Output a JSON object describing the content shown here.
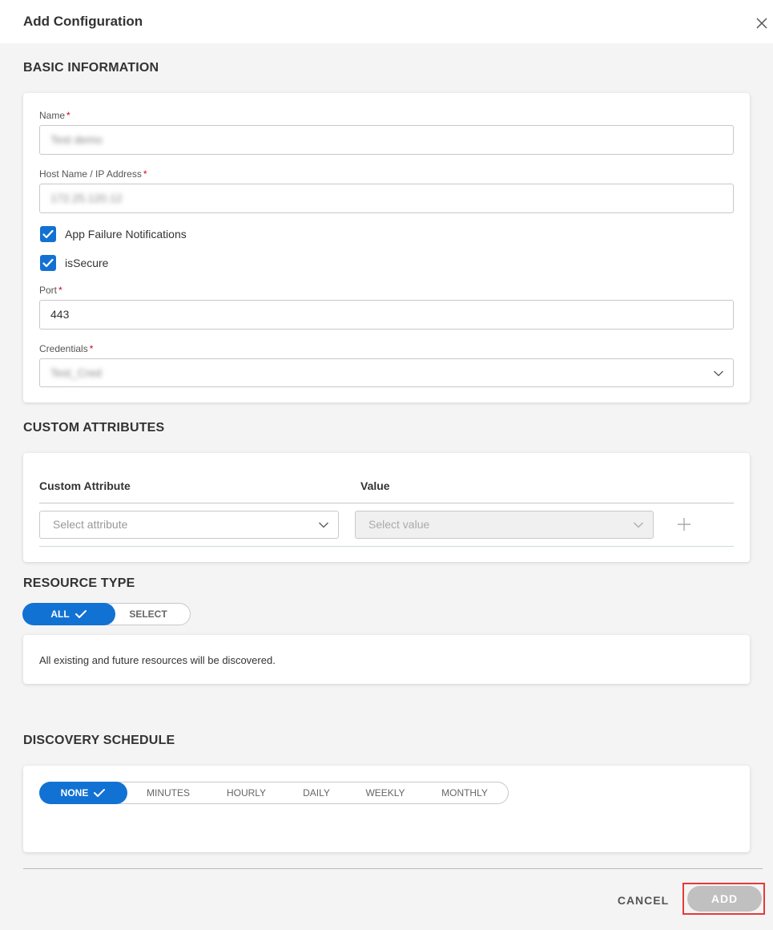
{
  "header": {
    "title": "Add Configuration",
    "close_icon": "close-icon"
  },
  "basic_info": {
    "section_title": "BASIC INFORMATION",
    "name": {
      "label": "Name",
      "required_mark": "*",
      "value": "Test demo"
    },
    "host": {
      "label": "Host Name / IP Address",
      "required_mark": "*",
      "value": "172.25.120.12"
    },
    "app_failure": {
      "label": "App Failure Notifications",
      "checked": true
    },
    "is_secure": {
      "label": "isSecure",
      "checked": true
    },
    "port": {
      "label": "Port",
      "required_mark": "*",
      "value": "443"
    },
    "credentials": {
      "label": "Credentials",
      "required_mark": "*",
      "value": "Test_Cred"
    }
  },
  "custom_attributes": {
    "section_title": "CUSTOM ATTRIBUTES",
    "col_attribute": "Custom Attribute",
    "col_value": "Value",
    "attribute_placeholder": "Select attribute",
    "value_placeholder": "Select value"
  },
  "resource_type": {
    "section_title": "RESOURCE TYPE",
    "options": [
      "ALL",
      "SELECT"
    ],
    "selected": "ALL",
    "description": "All existing and future resources will be discovered."
  },
  "discovery_schedule": {
    "section_title": "DISCOVERY SCHEDULE",
    "options": [
      "NONE",
      "MINUTES",
      "HOURLY",
      "DAILY",
      "WEEKLY",
      "MONTHLY"
    ],
    "selected": "NONE"
  },
  "footer": {
    "cancel_label": "CANCEL",
    "add_label": "ADD"
  },
  "colors": {
    "accent": "#1272d3",
    "required": "#d0021b",
    "highlight": "#e53a3a",
    "disabled_button": "#c0c0c0"
  }
}
